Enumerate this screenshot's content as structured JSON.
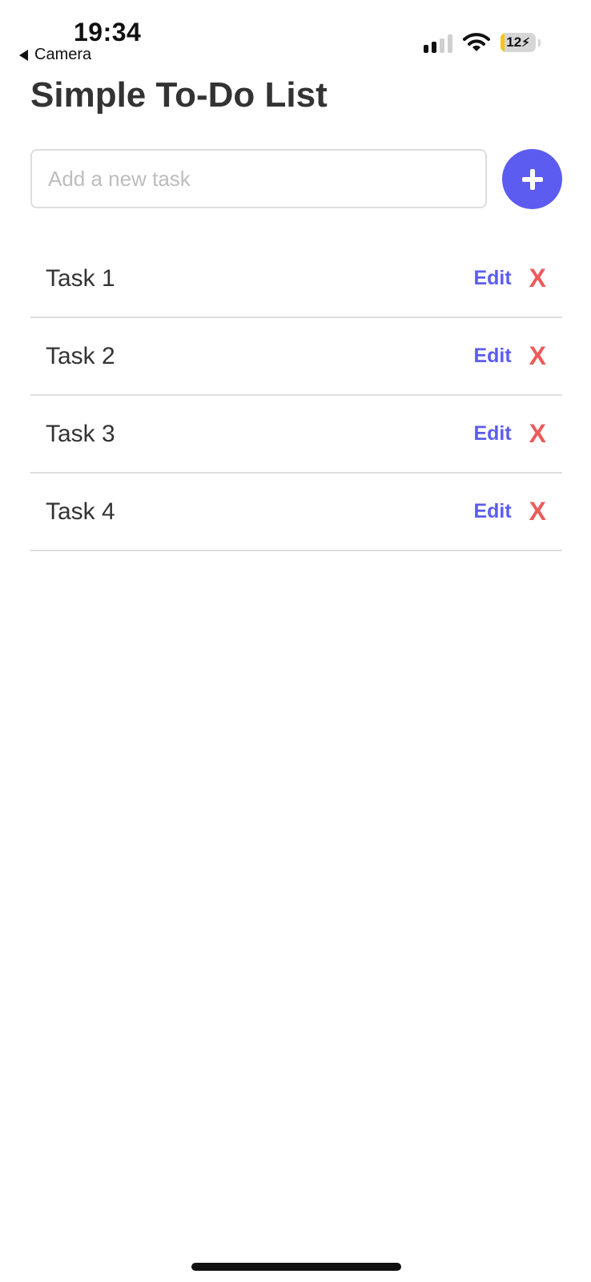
{
  "status_bar": {
    "time": "19:34",
    "back_label": "Camera",
    "battery_level": "12",
    "battery_percent": 12,
    "cellular_bars": 2,
    "cellular_bars_total": 4,
    "icons": [
      "back-arrow-icon",
      "cellular-signal-icon",
      "wifi-icon",
      "battery-charging-icon"
    ]
  },
  "header": {
    "title": "Simple To-Do List"
  },
  "new_task": {
    "placeholder": "Add a new task",
    "value": "",
    "add_icon": "plus-icon"
  },
  "tasks": [
    {
      "label": "Task 1",
      "edit_label": "Edit",
      "delete_label": "X"
    },
    {
      "label": "Task 2",
      "edit_label": "Edit",
      "delete_label": "X"
    },
    {
      "label": "Task 3",
      "edit_label": "Edit",
      "delete_label": "X"
    },
    {
      "label": "Task 4",
      "edit_label": "Edit",
      "delete_label": "X"
    }
  ],
  "colors": {
    "accent": "#5c5cf0",
    "delete": "#ee5a5a",
    "title_text": "#333333",
    "divider": "#dedede",
    "battery_low": "#f5c518"
  }
}
